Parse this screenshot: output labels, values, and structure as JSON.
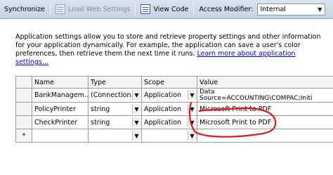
{
  "toolbar": {
    "synchronize_label": "Synchronize",
    "load_web_settings_label": "Load Web Settings",
    "view_code_label": "View Code",
    "access_modifier_label": "Access Modifier:",
    "access_modifier_value": "Internal"
  },
  "description": {
    "text": "Application settings allow you to store and retrieve property settings and other information for your application dynamically. For example, the application can save a user's color preferences, then retrieve them the next time it runs.",
    "link_text": "Learn more about application settings..."
  },
  "grid": {
    "columns": [
      "Name",
      "Type",
      "Scope",
      "Value"
    ],
    "rows": [
      {
        "marker": "",
        "name": "BankManagem...",
        "type": "(Connection...",
        "scope": "Application",
        "value_line1": "Data",
        "value_line2": "Source=ACCOUNTING\\COMPAC;Initi"
      },
      {
        "marker": "",
        "name": "PolicyPrinter",
        "type": "string",
        "scope": "Application",
        "value_line1": "Microsoft Print to PDF"
      },
      {
        "marker": "",
        "name": "CheckPrinter",
        "type": "string",
        "scope": "Application",
        "value_line1": "Microsoft Print to PDF"
      },
      {
        "marker": "*",
        "name": "",
        "type": "",
        "scope": "",
        "value_line1": ""
      }
    ]
  },
  "colors": {
    "toolbar_bg": "#c6d4e5",
    "link": "#0000ee",
    "annotation": "#e0191f"
  },
  "icons": {
    "load_web_settings": "load-settings-icon",
    "view_code": "view-code-icon",
    "dropdown": "chevron-down-icon"
  }
}
